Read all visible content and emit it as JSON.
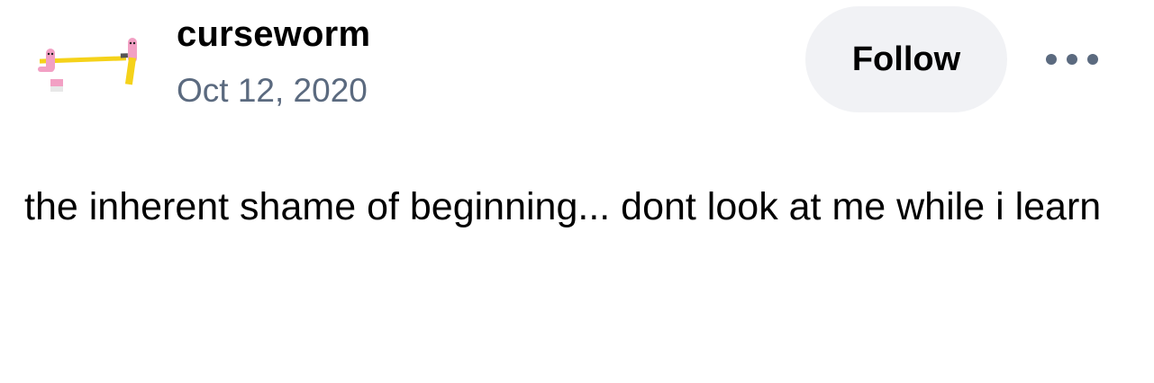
{
  "post": {
    "author": {
      "name": "curseworm",
      "avatar_icon": "worm-pencil-avatar-icon"
    },
    "date": "Oct 12, 2020",
    "follow_label": "Follow",
    "more_icon": "ellipsis-icon",
    "body": "the inherent shame of beginning... dont look at me while i learn"
  },
  "colors": {
    "follow_bg": "#f1f2f5",
    "date_text": "#5b6a7f",
    "more_icon": "#5b6a7f",
    "worm_pink": "#f2a0c4",
    "pencil_yellow": "#f5d21a"
  }
}
